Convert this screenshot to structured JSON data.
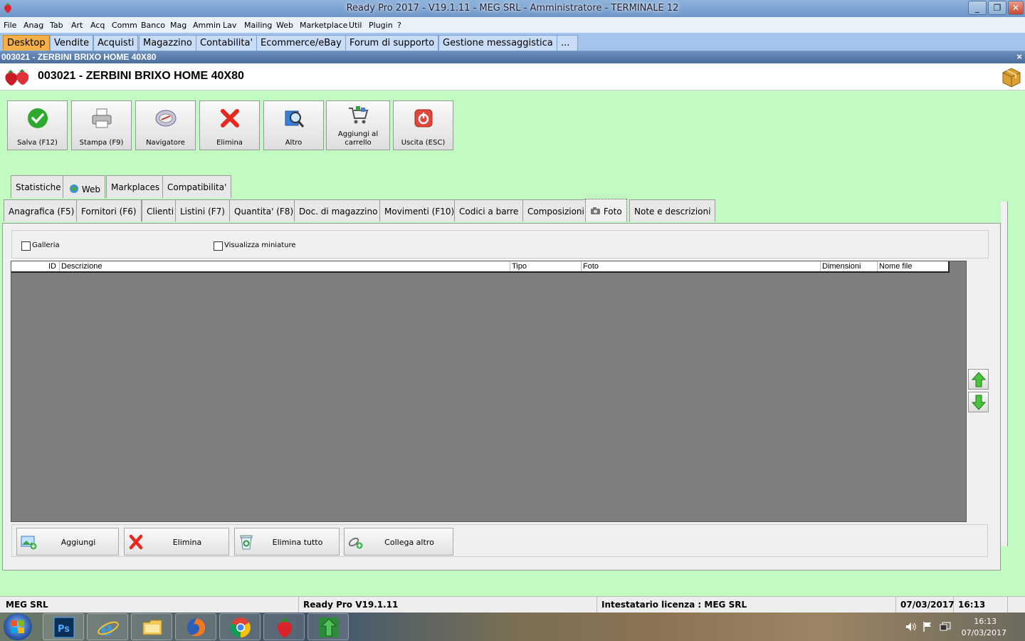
{
  "window": {
    "title": "Ready Pro 2017 - V19.1.11 - MEG SRL - Amministratore - TERMINALE 12",
    "minimize": "_",
    "maximize": "❐",
    "close": "✕"
  },
  "menu": [
    "File",
    "Anag",
    "Tab",
    "Art",
    "Acq",
    "Comm",
    "Banco",
    "Mag",
    "Ammin",
    "Lav",
    "Mailing",
    "Web",
    "Marketplace",
    "Util",
    "Plugin",
    "?"
  ],
  "app_tabs": [
    "Desktop",
    "Vendite",
    "Acquisti",
    "Magazzino",
    "Contabilita'",
    "Ecommerce/eBay",
    "Forum di supporto",
    "Gestione messaggistica",
    "..."
  ],
  "subwindow": {
    "title": "003021 - ZERBINI BRIXO HOME 40X80",
    "close": "×"
  },
  "header": {
    "title": "003021 - ZERBINI BRIXO HOME 40X80"
  },
  "toolbar": {
    "save": "Salva (F12)",
    "print": "Stampa (F9)",
    "navigator": "Navigatore",
    "delete": "Elimina",
    "other": "Altro",
    "cart": "Aggiungi al carrello",
    "exit": "Uscita (ESC)"
  },
  "tabs_top": [
    "Statistiche",
    "Web",
    "Markplaces",
    "Compatibilita'"
  ],
  "tabs_main": [
    "Anagrafica (F5)",
    "Fornitori (F6)",
    "Clienti",
    "Listini (F7)",
    "Quantita' (F8)",
    "Doc. di magazzino",
    "Movimenti (F10)",
    "Codici a barre",
    "Composizioni",
    "Foto",
    "Note e descrizioni"
  ],
  "options": {
    "gallery": "Galleria",
    "thumbnails": "Visualizza miniature"
  },
  "grid": {
    "columns": [
      "ID",
      "Descrizione",
      "Tipo",
      "Foto",
      "Dimensioni",
      "Nome file"
    ]
  },
  "buttons": {
    "add": "Aggiungi",
    "delete": "Elimina",
    "delete_all": "Elimina tutto",
    "link": "Collega altro"
  },
  "status": {
    "company": "MEG SRL",
    "version": "Ready Pro V19.1.11",
    "license": "Intestatario licenza : MEG SRL",
    "date": "07/03/2017",
    "time": "16:13"
  },
  "taskbar": {
    "apps": [
      "photoshop-icon",
      "internet-explorer-icon",
      "file-explorer-icon",
      "firefox-icon",
      "chrome-icon",
      "readypro-icon",
      "transfer-icon"
    ],
    "clock_time": "16:13",
    "clock_date": "07/03/2017"
  },
  "colors": {
    "background": "#c2fbc2",
    "active_tab": "#f5b049",
    "app_bar": "#a4c4ec",
    "grid": "#7f7f7f"
  }
}
